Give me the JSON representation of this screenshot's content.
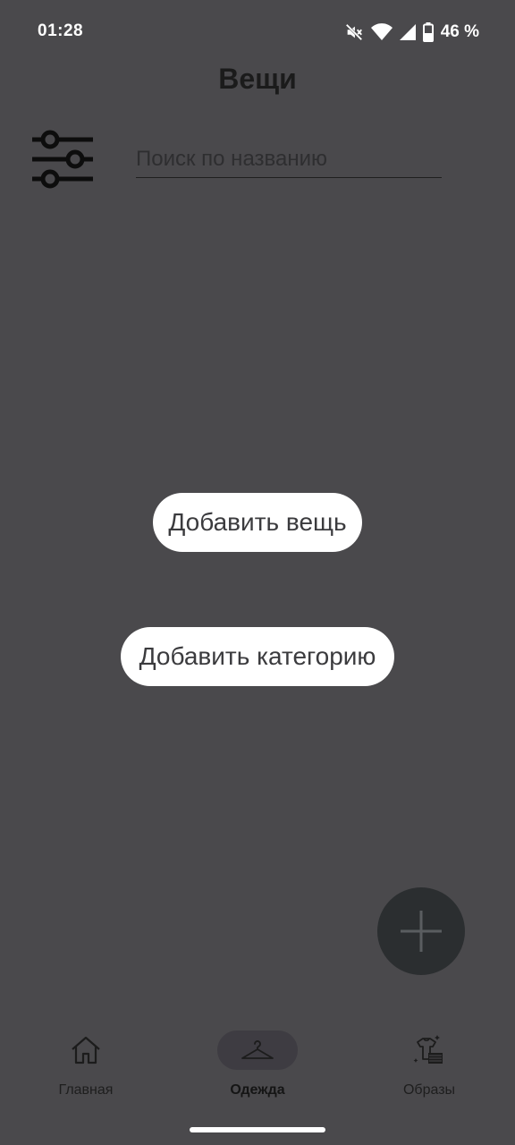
{
  "status": {
    "time": "01:28",
    "battery_percent": "46 %",
    "icons": [
      "mute-icon",
      "wifi-icon",
      "signal-icon",
      "battery-icon"
    ]
  },
  "header": {
    "title": "Вещи"
  },
  "search": {
    "placeholder": "Поиск по названию",
    "value": ""
  },
  "actions": {
    "add_item_label": "Добавить вещь",
    "add_category_label": "Добавить категорию"
  },
  "fab": {
    "icon": "plus-icon"
  },
  "nav": {
    "items": [
      {
        "label": "Главная",
        "icon": "home-icon",
        "active": false
      },
      {
        "label": "Одежда",
        "icon": "hanger-icon",
        "active": true
      },
      {
        "label": "Образы",
        "icon": "outfits-icon",
        "active": false
      }
    ]
  },
  "colors": {
    "background": "#4a494c",
    "pill": "#ffffff",
    "fab": "#2b2e30",
    "active_nav_indicator": "#3e3c42"
  }
}
